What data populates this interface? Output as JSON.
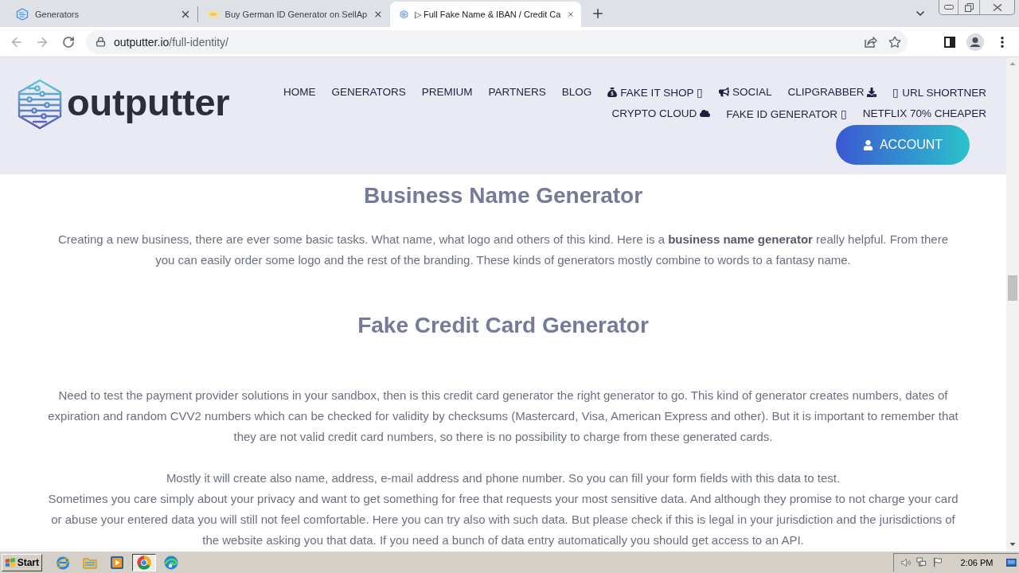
{
  "browser": {
    "tabs": [
      {
        "title": "Generators",
        "kind": "hex",
        "selected": false
      },
      {
        "title": "Buy German ID Generator on SellAp",
        "kind": "store",
        "selected": false
      },
      {
        "title": "▷ Full Fake Name & IBAN / Credit Ca",
        "kind": "hex",
        "selected": true
      }
    ],
    "back": {
      "disabled": true
    },
    "forward": {
      "disabled": true
    },
    "address": {
      "host": "outputter.io",
      "path": "/full-identity/"
    }
  },
  "site": {
    "logo": "outputter",
    "nav_rows": [
      [
        {
          "label": "HOME",
          "kind": "plain"
        },
        {
          "label": "GENERATORS",
          "kind": "plain"
        },
        {
          "label": "PREMIUM",
          "kind": "plain"
        },
        {
          "label": "PARTNERS",
          "kind": "plain"
        },
        {
          "label": "BLOG",
          "kind": "plain"
        },
        {
          "label": "FAKE IT SHOP ▯",
          "kind": "moneybag"
        },
        {
          "label": "SOCIAL",
          "kind": "megaphone"
        },
        {
          "label": "CLIPGRABBER",
          "kind": "download"
        },
        {
          "label": "▯ URL SHORTNER",
          "kind": "plain"
        }
      ],
      [
        {
          "label": "CRYPTO CLOUD",
          "kind": "cloud"
        },
        {
          "label": "FAKE ID GENERATOR ▯",
          "kind": "plain"
        },
        {
          "label": "NETFLIX 70% CHEAPER",
          "kind": "plain"
        }
      ]
    ],
    "account_button": "ACCOUNT"
  },
  "sections": [
    {
      "heading": "Business Name Generator",
      "paragraphs": [
        {
          "lines": [
            "Creating a new business, there are ever some basic tasks. What name, what logo and others of this kind. Here is a **business name generator** really helpful. From there you can easily order some logo and the rest of the branding. These kinds of generators mostly combine to words to a fantasy name."
          ]
        }
      ]
    },
    {
      "heading": "Fake Credit Card Generator",
      "paragraphs": [
        {
          "lines": [
            "Need to test the payment provider solutions in your sandbox, then is this credit card generator the right generator to go. This kind of generator creates numbers, dates of expiration and random CVV2 numbers which can be checked for validity by checksums (Mastercard, Visa, American Express and other). But it is important to remember that they are not valid credit card numbers, so there is no possibility to charge from these generated cards."
          ]
        },
        {
          "lines": [
            "Mostly it will create also name, address, e-mail address and phone number. So you can fill your form fields with this data to test.",
            "Sometimes you care simply about your privacy and want to get something for free that requests your most sensitive data. And although they promise to not charge your card or abuse your entered data you will still not feel comfortable. Here you can try also with such data. But please check if this is legal in your jurisdiction and the jurisdictions of the website asking you that data. If you need a bunch of data entry automatically you should get access to an API."
          ]
        }
      ]
    }
  ],
  "taskbar": {
    "start": "Start",
    "apps": [
      {
        "kind": "e-globe",
        "selected": false
      },
      {
        "kind": "folder",
        "selected": false
      },
      {
        "kind": "player",
        "selected": false
      },
      {
        "kind": "ring",
        "selected": true
      },
      {
        "kind": "wave",
        "selected": false
      }
    ],
    "clock": "2:06 PM"
  }
}
